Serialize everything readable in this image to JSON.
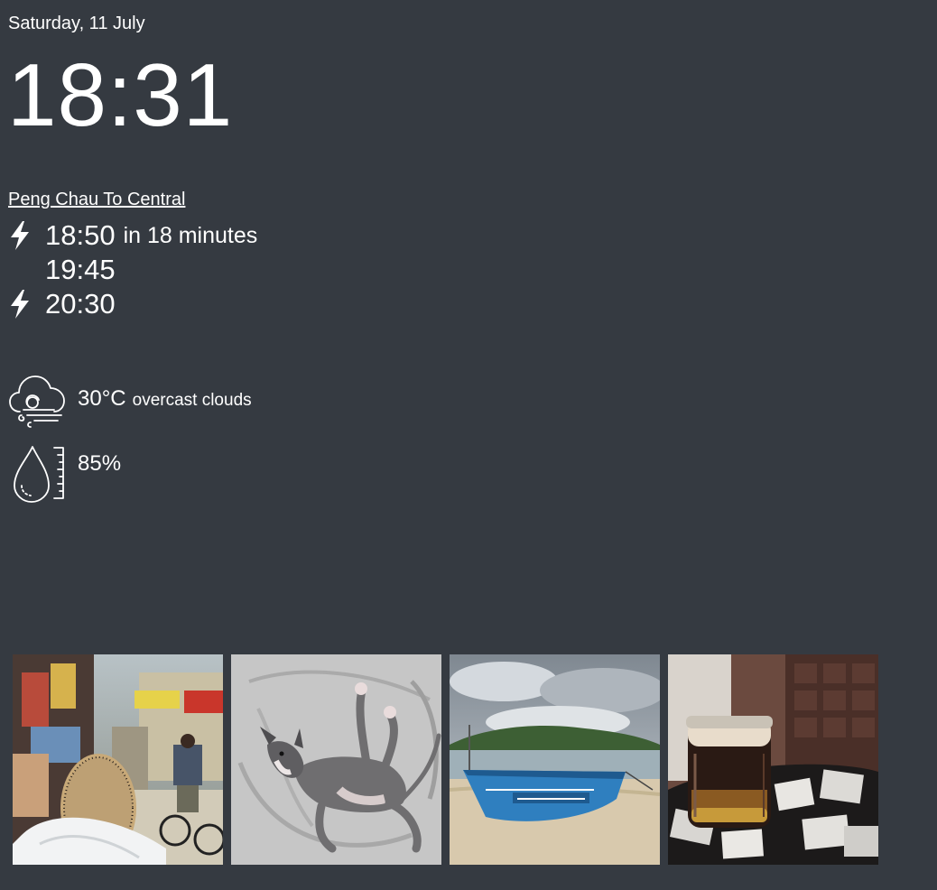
{
  "date": "Saturday, 11 July",
  "clock": "18:31",
  "ferry": {
    "route": "Peng Chau To Central",
    "departures": [
      {
        "time": "18:50",
        "relative": "in 18 minutes",
        "fast": true
      },
      {
        "time": "19:45",
        "relative": "",
        "fast": false
      },
      {
        "time": "20:30",
        "relative": "",
        "fast": true
      }
    ]
  },
  "weather": {
    "temperature": "30°C",
    "condition": "overcast clouds",
    "humidity": "85%",
    "icons": {
      "condition": "cloudy-wind-icon",
      "humidity": "humidity-drop-icon",
      "fast_ferry": "lightning-bolt-icon"
    }
  },
  "colors": {
    "background": "#353a41",
    "text": "#ffffff"
  }
}
